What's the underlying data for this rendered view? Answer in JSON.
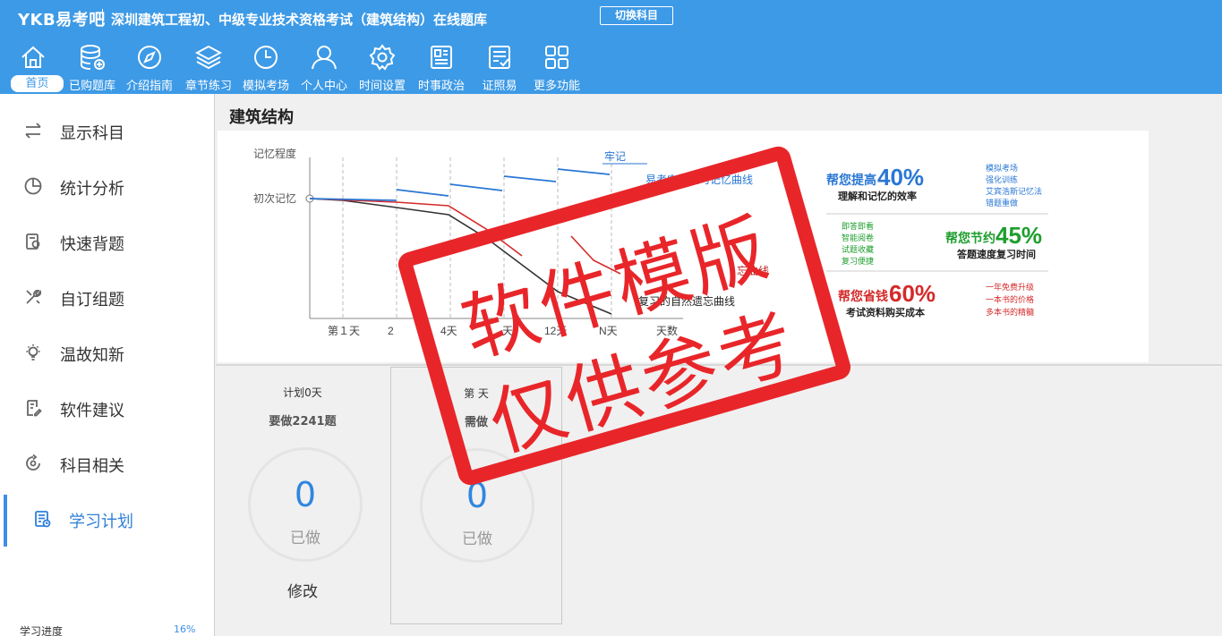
{
  "header": {
    "brand": "YKB易考吧",
    "title": "深圳建筑工程初、中级专业技术资格考试（建筑结构）在线题库",
    "switch_label": "切换科目"
  },
  "nav": [
    {
      "label": "首页",
      "icon": "home-icon",
      "active": true
    },
    {
      "label": "已购题库",
      "icon": "database-icon"
    },
    {
      "label": "介绍指南",
      "icon": "compass-icon"
    },
    {
      "label": "章节练习",
      "icon": "layers-icon"
    },
    {
      "label": "模拟考场",
      "icon": "clock-icon"
    },
    {
      "label": "个人中心",
      "icon": "user-icon"
    },
    {
      "label": "时间设置",
      "icon": "gear-icon"
    },
    {
      "label": "时事政治",
      "icon": "newspaper-icon"
    },
    {
      "label": "证照易",
      "icon": "checklist-icon"
    },
    {
      "label": "更多功能",
      "icon": "grid-icon"
    }
  ],
  "sidebar": {
    "items": [
      {
        "label": "显示科目",
        "icon": "swap-icon"
      },
      {
        "label": "统计分析",
        "icon": "pie-chart-icon"
      },
      {
        "label": "快速背题",
        "icon": "book-icon"
      },
      {
        "label": "自订组题",
        "icon": "tools-icon"
      },
      {
        "label": "温故知新",
        "icon": "lightbulb-icon"
      },
      {
        "label": "软件建议",
        "icon": "note-icon"
      },
      {
        "label": "科目相关",
        "icon": "refresh-icon"
      },
      {
        "label": "学习计划",
        "icon": "calendar-icon",
        "active": true
      }
    ],
    "progress_label": "学习进度",
    "progress_value": "16%"
  },
  "main": {
    "subject_title": "建筑结构",
    "banner": {
      "y_label_top": "记忆程度",
      "y_label_mid": "初次记忆",
      "x_ticks": [
        "第１天",
        "2",
        "4天",
        "天",
        "12天",
        "N天",
        "天数"
      ],
      "label_firm": "牢记",
      "label_ykb": "易考宝典复习记忆曲线",
      "label_forget": "忘曲线",
      "label_natural": "复习的自然遗忘曲线",
      "promo1_head": "帮您提高",
      "promo1_pct": "40%",
      "promo1_sub": "理解和记忆的效率",
      "promo1_list": [
        "模拟考场",
        "强化训练",
        "艾宾浩斯记忆法",
        "错题重做"
      ],
      "promo2_list": [
        "即答即看",
        "智能阅卷",
        "试题收藏",
        "复习便捷"
      ],
      "promo2_head": "帮您节约",
      "promo2_pct": "45%",
      "promo2_sub": "答题速度复习时间",
      "promo3_head": "帮您省钱",
      "promo3_pct": "60%",
      "promo3_sub": "考试资料购买成本",
      "promo3_list": [
        "一年免费升级",
        "一本书的价格",
        "多本书的精髓"
      ],
      "colors": {
        "ykb_line": "#2a77d4",
        "red_line": "#d42a2a",
        "black_line": "#333333",
        "green": "#1e9e2e"
      }
    },
    "plans": [
      {
        "line1": "计划0天",
        "line2": "要做2241题",
        "count": "0",
        "done_label": "已做",
        "modify_label": "修改"
      },
      {
        "line1": "第  天",
        "line2": "需做",
        "count": "0",
        "done_label": "已做"
      }
    ]
  },
  "watermark": {
    "line1": "软件模版",
    "line2": "仅供参考",
    "color": "#e8262a"
  }
}
